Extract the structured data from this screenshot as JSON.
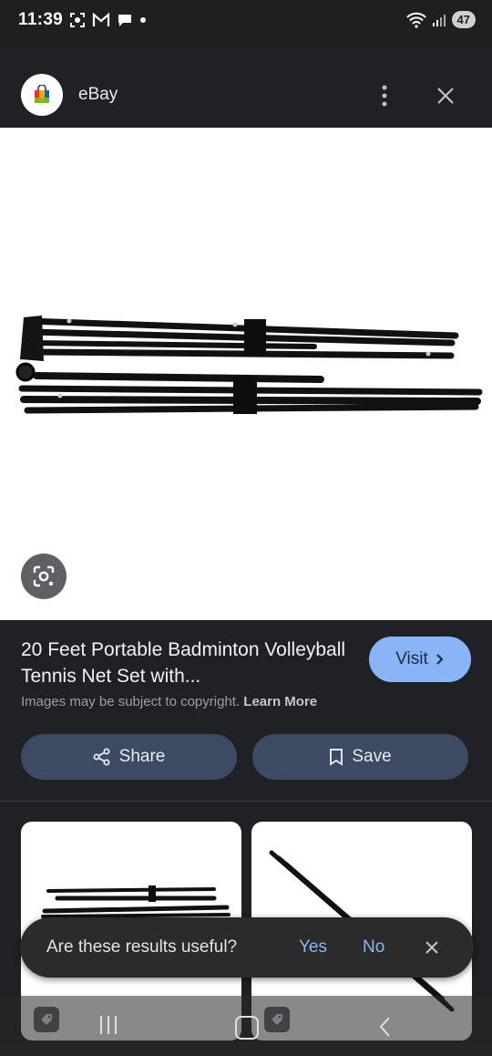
{
  "status_bar": {
    "time": "11:39",
    "battery": "47",
    "icons": [
      "screenshot-icon",
      "gmail-icon",
      "chat-icon",
      "notification-dot",
      "wifi-icon",
      "signal-icon"
    ]
  },
  "header": {
    "site_name": "eBay",
    "favicon": "ebay-shopping-bag-icon"
  },
  "result": {
    "title": "20 Feet Portable Badminton Volleyball Tennis Net Set with...",
    "visit_label": "Visit",
    "copyright_text": "Images may be subject to copyright.",
    "learn_more": "Learn More"
  },
  "actions": {
    "share_label": "Share",
    "save_label": "Save"
  },
  "feedback": {
    "question": "Are these results useful?",
    "yes": "Yes",
    "no": "No"
  },
  "colors": {
    "background": "#202124",
    "accent": "#8ab4f8",
    "action_button": "#3c4a63"
  }
}
